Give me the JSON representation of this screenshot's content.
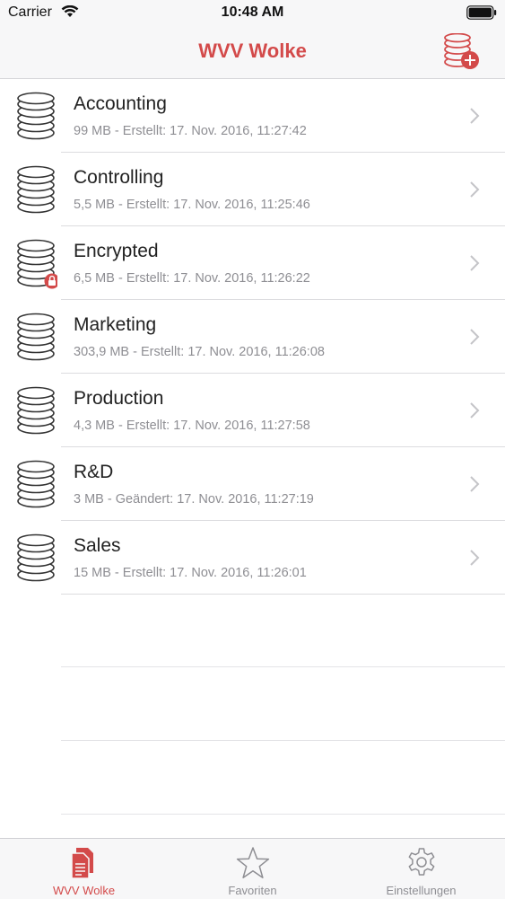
{
  "status_bar": {
    "carrier": "Carrier",
    "time": "10:48 AM"
  },
  "nav": {
    "title": "WVV Wolke"
  },
  "databases": [
    {
      "name": "Accounting",
      "meta": "99 MB - Erstellt: 17. Nov. 2016, 11:27:42",
      "locked": false
    },
    {
      "name": "Controlling",
      "meta": "5,5 MB - Erstellt: 17. Nov. 2016, 11:25:46",
      "locked": false
    },
    {
      "name": "Encrypted",
      "meta": "6,5 MB - Erstellt: 17. Nov. 2016, 11:26:22",
      "locked": true
    },
    {
      "name": "Marketing",
      "meta": "303,9 MB - Erstellt: 17. Nov. 2016, 11:26:08",
      "locked": false
    },
    {
      "name": "Production",
      "meta": "4,3 MB - Erstellt: 17. Nov. 2016, 11:27:58",
      "locked": false
    },
    {
      "name": "R&D",
      "meta": "3 MB - Geändert: 17. Nov. 2016, 11:27:19",
      "locked": false
    },
    {
      "name": "Sales",
      "meta": "15 MB - Erstellt: 17. Nov. 2016, 11:26:01",
      "locked": false
    }
  ],
  "tabs": [
    {
      "label": "WVV Wolke",
      "icon": "documents-icon",
      "active": true
    },
    {
      "label": "Favoriten",
      "icon": "star-icon",
      "active": false
    },
    {
      "label": "Einstellungen",
      "icon": "gear-icon",
      "active": false
    }
  ],
  "colors": {
    "accent": "#d34a4a",
    "secondary_text": "#8e8e93",
    "bar_background": "#f7f7f8"
  }
}
